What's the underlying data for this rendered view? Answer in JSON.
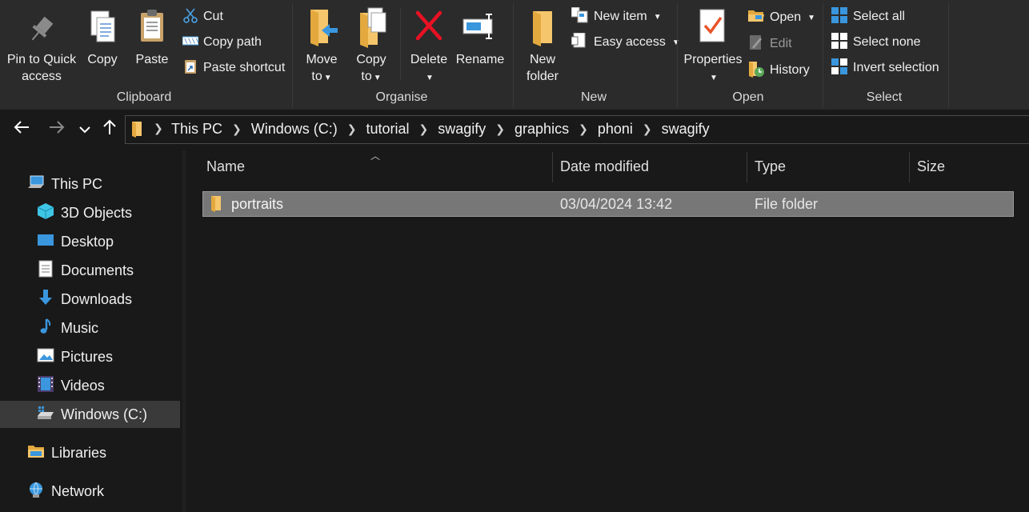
{
  "ribbon": {
    "clipboard": {
      "group_label": "Clipboard",
      "pin_label_1": "Pin to Quick",
      "pin_label_2": "access",
      "copy_label": "Copy",
      "paste_label": "Paste",
      "cut_label": "Cut",
      "copy_path_label": "Copy path",
      "paste_shortcut_label": "Paste shortcut"
    },
    "organise": {
      "group_label": "Organise",
      "move_to_1": "Move",
      "move_to_2": "to",
      "copy_to_1": "Copy",
      "copy_to_2": "to",
      "delete_label": "Delete",
      "rename_label": "Rename"
    },
    "new": {
      "group_label": "New",
      "new_folder_1": "New",
      "new_folder_2": "folder",
      "new_item_label": "New item",
      "easy_access_label": "Easy access"
    },
    "open": {
      "group_label": "Open",
      "properties_label": "Properties",
      "open_label": "Open",
      "edit_label": "Edit",
      "history_label": "History"
    },
    "select": {
      "group_label": "Select",
      "select_all_label": "Select all",
      "select_none_label": "Select none",
      "invert_selection_label": "Invert selection"
    }
  },
  "address_bar": {
    "crumbs": [
      "This PC",
      "Windows (C:)",
      "tutorial",
      "swagify",
      "graphics",
      "phoni",
      "swagify"
    ]
  },
  "sidebar": {
    "items": [
      "This PC",
      "3D Objects",
      "Desktop",
      "Documents",
      "Downloads",
      "Music",
      "Pictures",
      "Videos",
      "Windows (C:)",
      "Libraries",
      "Network"
    ]
  },
  "file_list": {
    "columns": [
      "Name",
      "Date modified",
      "Type",
      "Size"
    ],
    "rows": [
      {
        "name": "portraits",
        "date_modified": "03/04/2024 13:42",
        "type": "File folder",
        "size": ""
      }
    ]
  },
  "colors": {
    "background": "#191919",
    "ribbon": "#2b2b2b",
    "selection": "#777777",
    "folder": "#f5c66b",
    "accent_blue": "#3a96dd",
    "delete_red": "#e81123"
  }
}
